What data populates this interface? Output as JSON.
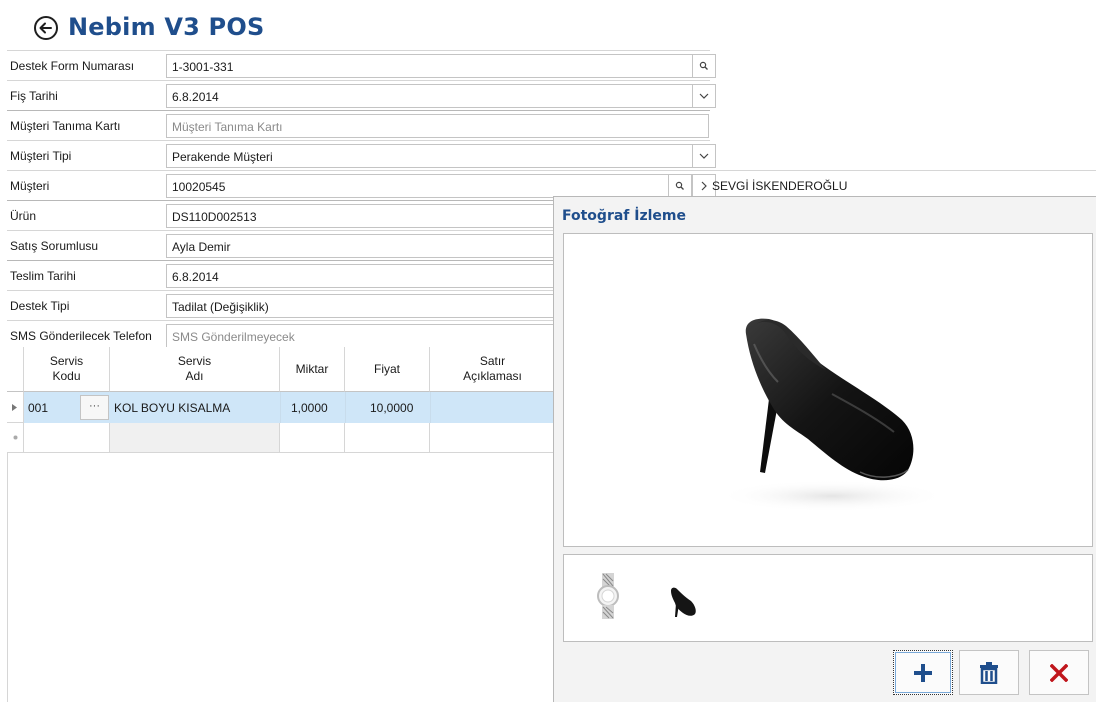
{
  "app": {
    "title": "Nebim V3 POS"
  },
  "form": {
    "destek_form_numarasi": {
      "label": "Destek Form Numarası",
      "value": "1-3001-331"
    },
    "fis_tarihi": {
      "label": "Fiş Tarihi",
      "value": "6.8.2014"
    },
    "musteri_tanima_karti": {
      "label": "Müşteri Tanıma Kartı",
      "placeholder": "Müşteri Tanıma Kartı"
    },
    "musteri_tipi": {
      "label": "Müşteri Tipi",
      "value": "Perakende Müşteri"
    },
    "musteri": {
      "label": "Müşteri",
      "value": "10020545",
      "name": "SEVGİ İSKENDEROĞLU"
    },
    "urun": {
      "label": "Ürün",
      "value": "DS110D002513"
    },
    "satis_sorumlusu": {
      "label": "Satış Sorumlusu",
      "value": "Ayla Demir"
    },
    "teslim_tarihi": {
      "label": "Teslim Tarihi",
      "value": "6.8.2014"
    },
    "destek_tipi": {
      "label": "Destek Tipi",
      "value": "Tadilat (Değişiklik)"
    },
    "sms_telefon": {
      "label": "SMS Gönderilecek Telefon",
      "placeholder": "SMS Gönderilmeyecek"
    }
  },
  "grid": {
    "columns": {
      "servis_kodu_1": "Servis",
      "servis_kodu_2": "Kodu",
      "servis_adi_1": "Servis",
      "servis_adi_2": "Adı",
      "miktar": "Miktar",
      "fiyat": "Fiyat",
      "satir_aciklamasi_1": "Satır",
      "satir_aciklamasi_2": "Açıklaması"
    },
    "rows": [
      {
        "kod": "001",
        "ellipsis": "···",
        "adi": "KOL BOYU KISALMA",
        "miktar": "1,0000",
        "fiyat": "10,0000",
        "aciklama": ""
      }
    ]
  },
  "photo": {
    "title": "Fotoğraf İzleme",
    "thumbnails": [
      "watch-thumbnail",
      "shoe-thumbnail"
    ],
    "buttons": {
      "add": "plus-icon",
      "delete": "trash-icon",
      "close": "close-icon"
    }
  },
  "colors": {
    "accent": "#1f4e8c",
    "selection": "#cfe6f8",
    "close": "#c0161c"
  }
}
